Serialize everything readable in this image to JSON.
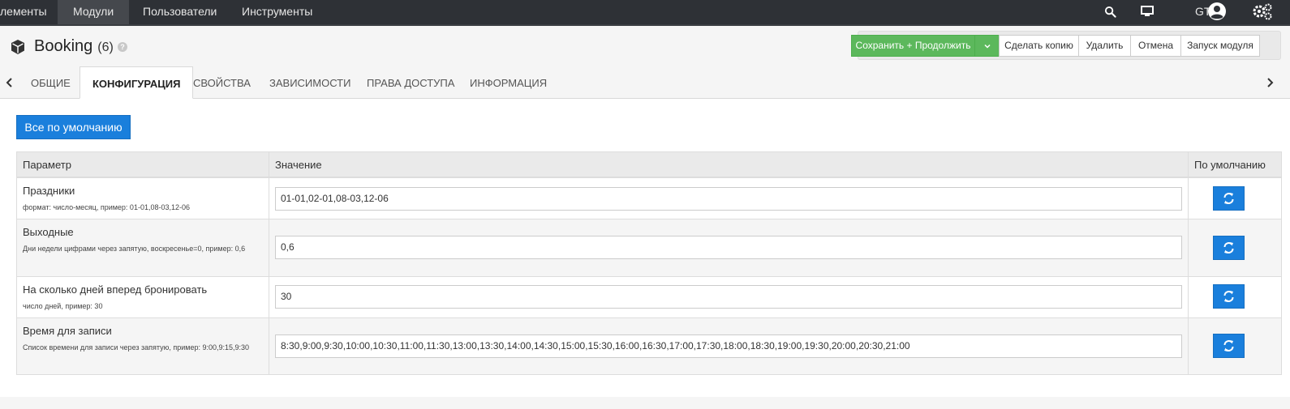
{
  "topnav": {
    "items": [
      "лементы",
      "Модули",
      "Пользователи",
      "Инструменты"
    ],
    "user": "GTX"
  },
  "header": {
    "title": "Booking",
    "count": "(6)",
    "help": "?"
  },
  "toolbar": {
    "save_continue": "Сохранить + Продолжить",
    "copy": "Сделать копию",
    "delete": "Удалить",
    "cancel": "Отмена",
    "run": "Запуск модуля"
  },
  "tabs": [
    "ОБЩИЕ",
    "КОНФИГУРАЦИЯ",
    "СВОЙСТВА",
    "ЗАВИСИМОСТИ",
    "ПРАВА ДОСТУПА",
    "ИНФОРМАЦИЯ"
  ],
  "active_tab": "КОНФИГУРАЦИЯ",
  "default_all": "Все по умолчанию",
  "table": {
    "headers": [
      "Параметр",
      "Значение",
      "По умолчанию"
    ],
    "rows": [
      {
        "name": "Праздники",
        "desc": "формат: число-месяц, пример: 01-01,08-03,12-06",
        "value": "01-01,02-01,08-03,12-06"
      },
      {
        "name": "Выходные",
        "desc": "Дни недели цифрами через запятую, воскресенье=0, пример: 0,6",
        "value": "0,6"
      },
      {
        "name": "На сколько дней вперед бронировать",
        "desc": "число дней, пример: 30",
        "value": "30"
      },
      {
        "name": "Время для записи",
        "desc": "Список времени для записи через запятую, пример: 9:00,9:15,9:30",
        "value": "8:30,9:00,9:30,10:00,10:30,11:00,11:30,13:00,13:30,14:00,14:30,15:00,15:30,16:00,16:30,17:00,17:30,18:00,18:30,19:00,19:30,20:00,20:30,21:00"
      }
    ]
  },
  "colors": {
    "primary": "#1a7fdc",
    "success": "#5cb85c",
    "nav": "#2e3136"
  }
}
